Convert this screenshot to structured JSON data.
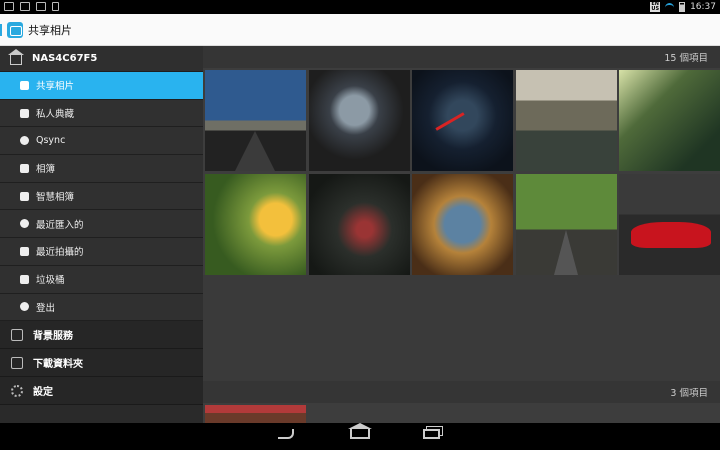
{
  "status_bar": {
    "lang_top": "EN",
    "lang_bottom": "US",
    "time": "16:37"
  },
  "action_bar": {
    "title": "共享相片"
  },
  "sidebar": {
    "nas_name": "NAS4C67F5",
    "items": [
      {
        "label": "共享相片",
        "icon": "shared-photos-icon",
        "active": true
      },
      {
        "label": "私人典藏",
        "icon": "lock-icon"
      },
      {
        "label": "Qsync",
        "icon": "qsync-icon"
      },
      {
        "label": "相簿",
        "icon": "album-icon"
      },
      {
        "label": "智慧相簿",
        "icon": "smart-album-icon"
      },
      {
        "label": "最近匯入的",
        "icon": "recent-import-icon"
      },
      {
        "label": "最近拍攝的",
        "icon": "recent-taken-icon"
      },
      {
        "label": "垃圾桶",
        "icon": "trash-icon"
      },
      {
        "label": "登出",
        "icon": "logout-icon"
      }
    ],
    "sections": [
      {
        "label": "背景服務",
        "icon": "background-service-icon"
      },
      {
        "label": "下載資料夾",
        "icon": "download-folder-icon"
      },
      {
        "label": "設定",
        "icon": "gear-icon"
      }
    ]
  },
  "content": {
    "groups": [
      {
        "count_label": "15 個項目"
      },
      {
        "count_label": "3 個項目"
      }
    ]
  },
  "colors": {
    "accent": "#29b3ef",
    "sidebar_bg": "#2a2a2a",
    "content_bg": "#3d3d3d"
  }
}
